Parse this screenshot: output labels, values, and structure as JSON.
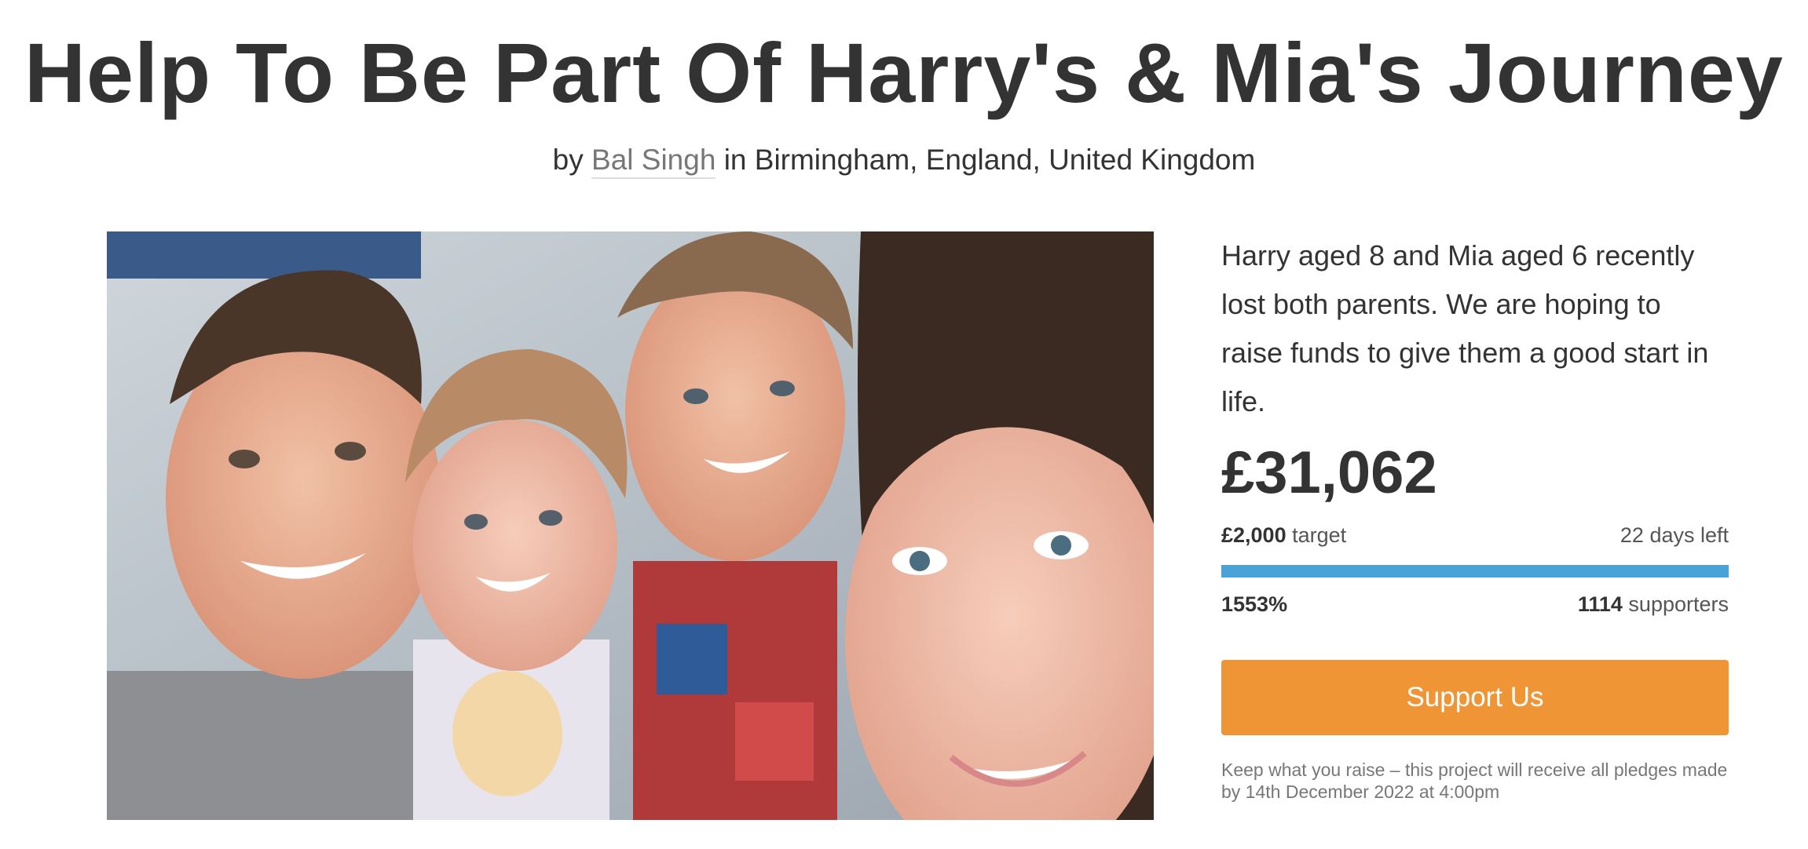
{
  "page": {
    "title": "Help To Be Part Of Harry's & Mia's Journey"
  },
  "byline": {
    "prefix": "by",
    "author": "Bal Singh",
    "location_text": "in Birmingham, England, United Kingdom"
  },
  "hero_image": {
    "description_icon": "family-photo"
  },
  "project": {
    "description": "Harry aged 8 and Mia aged 6 recently lost both parents. We are hoping to raise funds to give them a good start in life.",
    "amount_raised": "£31,062",
    "target_amount": "£2,000",
    "target_label": "target",
    "days_left": "22 days left",
    "percent_funded": "1553%",
    "progress_fraction": 1.0,
    "supporters_count": "1114",
    "supporters_label": "supporters",
    "support_button_label": "Support Us",
    "fine_print": "Keep what you raise – this project will receive all pledges made by 14th December 2022 at 4:00pm"
  },
  "colors": {
    "accent_button": "#f09535",
    "progress_bar": "#4aa3d8",
    "text_primary": "#333333",
    "text_muted": "#777777"
  }
}
